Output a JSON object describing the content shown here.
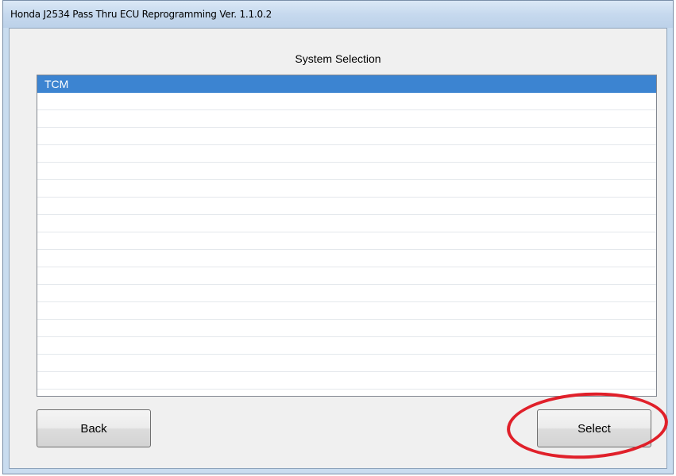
{
  "window": {
    "title": "Honda J2534 Pass Thru ECU Reprogramming Ver. 1.1.0.2"
  },
  "main": {
    "heading": "System Selection",
    "systems": [
      "TCM",
      "",
      "",
      "",
      "",
      "",
      "",
      "",
      "",
      "",
      "",
      "",
      "",
      "",
      "",
      "",
      "",
      ""
    ],
    "selected_index": 0
  },
  "buttons": {
    "back_label": "Back",
    "select_label": "Select"
  },
  "colors": {
    "selection": "#3c84d1",
    "annotation_ring": "#e0202a"
  }
}
